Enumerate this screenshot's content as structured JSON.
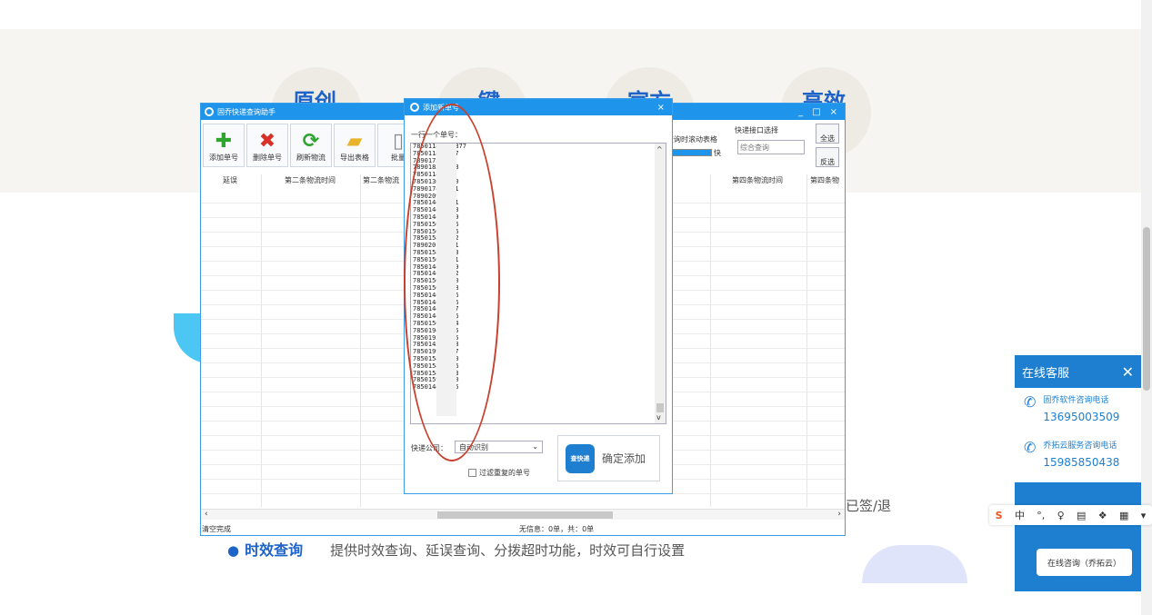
{
  "banner": {
    "features": [
      {
        "title": "原创"
      },
      {
        "title": "一键"
      },
      {
        "title": "官方"
      },
      {
        "title": "高效"
      }
    ]
  },
  "main_window": {
    "title": "固乔快递查询助手",
    "controls": [
      "_",
      "□",
      "×"
    ],
    "toolbar": [
      {
        "label": "添加单号",
        "icon": "plus-icon",
        "color": "#2fa52f"
      },
      {
        "label": "删除单号",
        "icon": "delete-icon",
        "color": "#d9302a"
      },
      {
        "label": "刷新物流",
        "icon": "refresh-icon",
        "color": "#2fa52f"
      },
      {
        "label": "导出表格",
        "icon": "folder-icon",
        "color": "#e8b22a"
      },
      {
        "label": "批量",
        "icon": "batch-icon",
        "color": "#888888"
      }
    ],
    "columns": [
      "延误",
      "第二条物流时间",
      "第二条物流",
      "第四条物流时间",
      "第四条物"
    ],
    "right_panel": {
      "scroll_label": "查询时滚动表格",
      "speed_label": "快",
      "interface_label": "快递接口选择",
      "interface_value": "综合查询",
      "select_all": "全选",
      "invert": "反选"
    },
    "status_left": "清空完成",
    "status_center": "无信息：0单，共：0单"
  },
  "dialog": {
    "title": "添加新单号",
    "close": "×",
    "instruction": "一行一个单号：",
    "numbers": [
      "78501186969877",
      "785011869727",
      "78901750165",
      "789018347328",
      "78501186832",
      "785013097510",
      "789017491561",
      "78902093274",
      "785014493131",
      "785014493113",
      "785014493139",
      "785015023366",
      "785015023676",
      "785015893792",
      "789020186991",
      "785015893773",
      "785015024211",
      "785014495739",
      "785014453052",
      "785015004740",
      "785015030568",
      "785014486266",
      "785014457576",
      "785014483897",
      "785014445526",
      "785015069764",
      "785019463235",
      "785019363605",
      "785014562798",
      "785019986927",
      "785015871850",
      "785015871926",
      "785015899463",
      "785015986930",
      "785014485315"
    ],
    "company_label": "快递公司：",
    "company_value": "自动识别",
    "filter_label": "过滤重复的单号",
    "add_button": "确定添加",
    "logo_text": "查快递"
  },
  "page": {
    "signed_text": "已签/退",
    "bullet_title": "时效查询",
    "bullet_desc": "提供时效查询、延误查询、分拨超时功能，时效可自行设置"
  },
  "chat": {
    "title": "在线客服",
    "close": "✕",
    "contacts": [
      {
        "name": "固乔软件咨询电话",
        "phone": "13695003509"
      },
      {
        "name": "乔拓云服务咨询电话",
        "phone": "15985850438"
      }
    ],
    "consult_button": "在线咨询（乔拓云）"
  },
  "ime": {
    "mode": "中"
  },
  "colors": {
    "accent": "#1e95ea",
    "annotation": "#c8412f",
    "brand": "#1e63c8"
  }
}
